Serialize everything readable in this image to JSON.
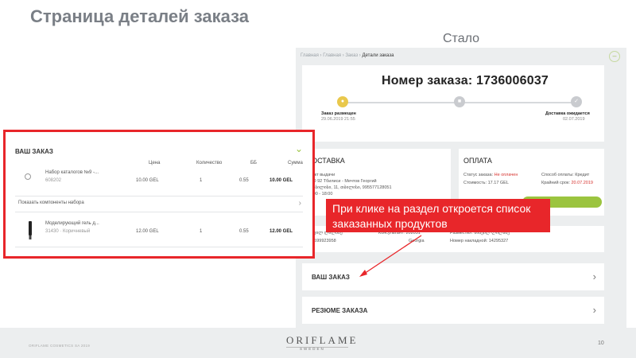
{
  "slide": {
    "title": "Страница деталей заказа",
    "after_label": "Стало",
    "callout": "При клике на раздел откроется список заказанных продуктов",
    "accent_red": "#e8262a",
    "accent_green": "#9bc43f"
  },
  "screen": {
    "breadcrumb": [
      "Главная",
      "Главная",
      "Заказ"
    ],
    "breadcrumb_current": "Детали заказа",
    "order_title": "Номер заказа: 1736006037",
    "steps": [
      {
        "label": "Заказ размещен",
        "date": "29.06.2019 21:55"
      },
      {
        "label": "Доставка ожидается",
        "date": "02.07.2019"
      }
    ],
    "delivery": {
      "title": "ДОСТАВКА",
      "lines": [
        "Пункт выдачи",
        "ТПО 92 Тбилиси - Мечтов Георгий",
        "ქ. თბილისი, 11, თბილისი, 995577128051",
        "10:00 - 18:00"
      ]
    },
    "payment": {
      "title": "ОПЛАТА",
      "status_label": "Статус заказа:",
      "status_value": "Не оплачен",
      "method_label": "Способ оплаты:",
      "method_value": "Кредит",
      "cost_label": "Стоимость:",
      "cost_value": "17.17 GEL",
      "due_label": "Крайний срок:",
      "due_value": "20.07.2019"
    },
    "info": {
      "name": "მიხეილ ლილაძე",
      "phone": "995599923958",
      "consultant_label": "Консультант:",
      "consultant_value": "202031",
      "country": "Georgia",
      "placer_label": "Разместил:",
      "placer_value": "მიხეილ ლილაძე",
      "invoice_label": "Номер накладной:",
      "invoice_value": "14295327"
    },
    "rows": [
      "ВАШ ЗАКАЗ",
      "РЕЗЮМЕ ЗАКАЗА"
    ]
  },
  "zoom": {
    "title": "ВАШ ЗАКАЗ",
    "columns": [
      "Цена",
      "Количество",
      "ББ",
      "Сумма"
    ],
    "items": [
      {
        "name": "Набор каталогов №9 -...",
        "code": "608202",
        "price": "10.00 GEL",
        "qty": "1",
        "bb": "0.55",
        "sum": "10.00 GEL"
      },
      {
        "name": "Моделирующий гель д...",
        "code": "31430 · Коричневый",
        "price": "12.00 GEL",
        "qty": "1",
        "bb": "0.55",
        "sum": "12.00 GEL"
      }
    ],
    "show_components": "Показать компоненты набора"
  },
  "footer": {
    "copyright": "ORIFLAME COSMETICS SA 2019",
    "logo": "ORIFLAME",
    "logo_sub": "SWEDEN",
    "page": "10"
  }
}
